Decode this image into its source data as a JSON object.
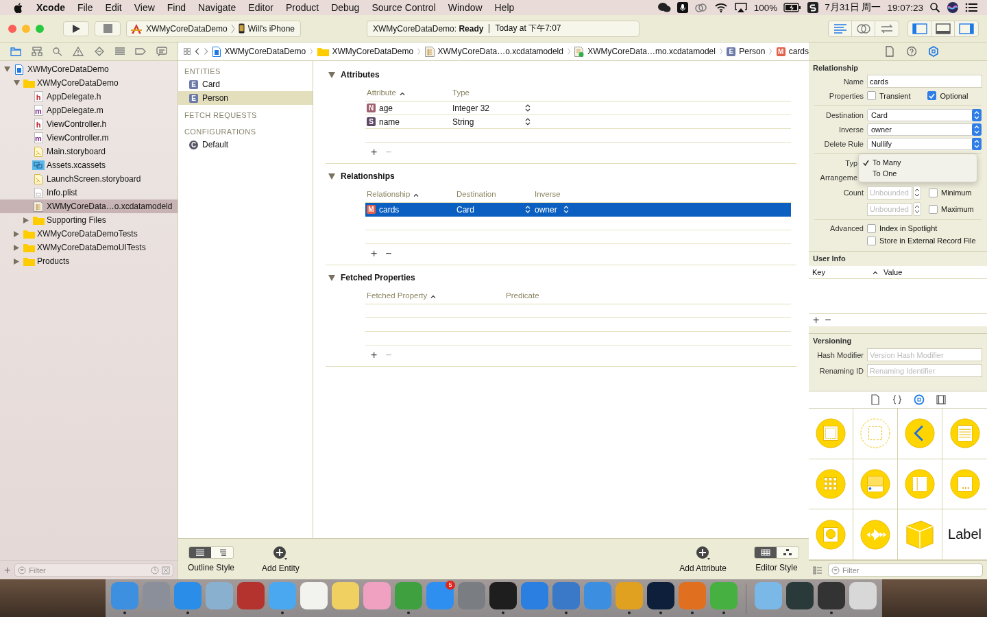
{
  "menu_bar": {
    "app": "Xcode",
    "items": [
      "File",
      "Edit",
      "View",
      "Find",
      "Navigate",
      "Editor",
      "Product",
      "Debug",
      "Source Control",
      "Window",
      "Help"
    ],
    "battery": "100%",
    "date": "7月31日 周一",
    "time": "19:07:23"
  },
  "toolbar": {
    "scheme": "XWMyCoreDataDemo",
    "device": "Will's iPhone",
    "status": "XWMyCoreDataDemo: **Ready**",
    "status_time": "Today at 下午7:07",
    "editor_modes": [
      {
        "kind": "standard",
        "selected": true
      },
      {
        "kind": "assistant",
        "selected": false
      },
      {
        "kind": "version",
        "selected": false
      }
    ],
    "panels": [
      {
        "kind": "left",
        "on": true
      },
      {
        "kind": "bottom",
        "on": false
      },
      {
        "kind": "right",
        "on": true
      }
    ]
  },
  "navigator": {
    "tabs": [
      {
        "kind": "folder",
        "selected": true
      },
      {
        "kind": "hierarchy",
        "selected": false
      },
      {
        "kind": "search",
        "selected": false
      },
      {
        "kind": "warning",
        "selected": false
      },
      {
        "kind": "test",
        "selected": false
      },
      {
        "kind": "debug",
        "selected": false
      },
      {
        "kind": "breakpoint",
        "selected": false
      },
      {
        "kind": "report",
        "selected": false
      }
    ],
    "tree": [
      {
        "label": "XWMyCoreDataDemo",
        "kind": "project",
        "expanded": true,
        "selected": false,
        "children": [
          {
            "label": "XWMyCoreDataDemo",
            "kind": "folder",
            "expanded": true,
            "selected": false,
            "children": [
              {
                "label": "AppDelegate.h",
                "kind": "source",
                "badge": "h",
                "selected": false
              },
              {
                "label": "AppDelegate.m",
                "kind": "source",
                "badge": "m",
                "selected": false
              },
              {
                "label": "ViewController.h",
                "kind": "source",
                "badge": "h",
                "selected": false
              },
              {
                "label": "ViewController.m",
                "kind": "source",
                "badge": "m",
                "selected": false
              },
              {
                "label": "Main.storyboard",
                "kind": "storyboard",
                "selected": false
              },
              {
                "label": "Assets.xcassets",
                "kind": "assets",
                "selected": false
              },
              {
                "label": "LaunchScreen.storyboard",
                "kind": "storyboard",
                "selected": false
              },
              {
                "label": "Info.plist",
                "kind": "plist",
                "selected": false
              },
              {
                "label": "XWMyCoreData…o.xcdatamodeld",
                "kind": "model",
                "selected": true
              },
              {
                "label": "Supporting Files",
                "kind": "folder",
                "expanded": false,
                "selected": false
              }
            ]
          },
          {
            "label": "XWMyCoreDataDemoTests",
            "kind": "folder",
            "expanded": false,
            "selected": false
          },
          {
            "label": "XWMyCoreDataDemoUITests",
            "kind": "folder",
            "expanded": false,
            "selected": false
          },
          {
            "label": "Products",
            "kind": "folder",
            "expanded": false,
            "selected": false
          }
        ]
      }
    ],
    "add": "+",
    "filter_placeholder": "Filter"
  },
  "breadcrumbs": [
    {
      "label": "XWMyCoreDataDemo",
      "kind": "project"
    },
    {
      "label": "XWMyCoreDataDemo",
      "kind": "folder"
    },
    {
      "label": "XWMyCoreData…o.xcdatamodeld",
      "kind": "model"
    },
    {
      "label": "XWMyCoreData…mo.xcdatamodel",
      "kind": "modelfile"
    },
    {
      "label": "Person",
      "kind": "badge",
      "badge": "E",
      "color": "#6c7aa8"
    },
    {
      "label": "cards",
      "kind": "badge",
      "badge": "M",
      "color": "#e0604a"
    }
  ],
  "entity_list": {
    "sections": [
      {
        "title": "ENTITIES",
        "items": [
          {
            "label": "Card",
            "badge": "E",
            "kind": "entity",
            "selected": false
          },
          {
            "label": "Person",
            "badge": "E",
            "kind": "entity",
            "selected": true
          }
        ]
      },
      {
        "title": "FETCH REQUESTS"
      },
      {
        "title": "CONFIGURATIONS",
        "items": [
          {
            "label": "Default",
            "badge": "C",
            "kind": "configuration",
            "selected": false
          }
        ]
      }
    ]
  },
  "editor": {
    "sections": [
      {
        "title": "Attributes",
        "expanded": true,
        "columns": [
          "Attribute",
          "Type"
        ],
        "rows": [
          {
            "badge": "N",
            "cells": [
              "age",
              "Integer 32"
            ],
            "selected": false
          },
          {
            "badge": "S",
            "cells": [
              "name",
              "String"
            ],
            "selected": false
          }
        ],
        "add": "+",
        "remove": "−",
        "remove_disabled": true
      },
      {
        "title": "Relationships",
        "expanded": true,
        "columns": [
          "Relationship",
          "Destination",
          "Inverse"
        ],
        "rows": [
          {
            "badge": "M",
            "cells": [
              "cards",
              "Card",
              "owner"
            ],
            "selected": true
          }
        ],
        "add": "+",
        "remove": "−",
        "remove_disabled": false
      },
      {
        "title": "Fetched Properties",
        "expanded": true,
        "columns": [
          "Fetched Property",
          "Predicate"
        ],
        "add": "+",
        "remove": "−",
        "remove_disabled": true
      }
    ]
  },
  "bottom_bar": {
    "outline_style": {
      "label": "Outline Style",
      "segments": [
        {
          "kind": "table",
          "selected": true
        },
        {
          "kind": "list",
          "selected": false
        }
      ]
    },
    "add_entity": "Add Entity",
    "add_attribute": "Add Attribute",
    "editor_style": {
      "label": "Editor Style",
      "segments": [
        {
          "kind": "table",
          "selected": true
        },
        {
          "kind": "graph",
          "selected": false
        }
      ]
    }
  },
  "inspector": {
    "tabs": [
      {
        "kind": "file",
        "selected": false
      },
      {
        "kind": "help",
        "selected": false
      },
      {
        "kind": "attributes",
        "selected": true
      }
    ],
    "relationship": {
      "title": "Relationship",
      "name_label": "Name",
      "name": "cards",
      "properties_label": "Properties",
      "properties": [
        {
          "label": "Transient",
          "checked": false
        },
        {
          "label": "Optional",
          "checked": true
        }
      ],
      "popups": [
        {
          "label": "Destination",
          "value": "Card"
        },
        {
          "label": "Inverse",
          "value": "owner"
        },
        {
          "label": "Delete Rule",
          "value": "Nullify"
        }
      ],
      "type_label": "Typ",
      "arrangement_label": "Arrangeme",
      "type_menu": [
        {
          "label": "To Many",
          "checked": true
        },
        {
          "label": "To One",
          "checked": false
        }
      ],
      "count_label": "Count",
      "count": [
        {
          "placeholder": "Unbounded",
          "label": "Minimum",
          "checked": false
        },
        {
          "placeholder": "Unbounded",
          "label": "Maximum",
          "checked": false
        }
      ],
      "advanced_label": "Advanced",
      "advanced": [
        {
          "label": "Index in Spotlight",
          "checked": false
        },
        {
          "label": "Store in External Record File",
          "checked": false
        }
      ]
    },
    "user_info": {
      "title": "User Info",
      "columns": [
        "Key",
        "Value"
      ],
      "add": "+",
      "remove": "−"
    },
    "versioning": {
      "title": "Versioning",
      "fields": [
        {
          "label": "Hash Modifier",
          "placeholder": "Version Hash Modifier"
        },
        {
          "label": "Renaming ID",
          "placeholder": "Renaming Identifier"
        }
      ]
    },
    "library": {
      "tabs": [
        {
          "kind": "file",
          "selected": false
        },
        {
          "kind": "code",
          "selected": false
        },
        {
          "kind": "object",
          "selected": true
        },
        {
          "kind": "media",
          "selected": false
        }
      ],
      "items": [
        {
          "kind": "view"
        },
        {
          "kind": "container"
        },
        {
          "kind": "back"
        },
        {
          "kind": "table"
        },
        {
          "kind": "grid"
        },
        {
          "kind": "tabbar"
        },
        {
          "kind": "split"
        },
        {
          "kind": "page"
        },
        {
          "kind": "button"
        },
        {
          "kind": "media"
        },
        {
          "kind": "cube"
        },
        {
          "kind": "label",
          "text": "Label"
        }
      ],
      "filter_placeholder": "Filter"
    }
  },
  "dock": {
    "apps": [
      {
        "color": "#3d8fe0",
        "running": true
      },
      {
        "color": "#8a8f99",
        "running": false
      },
      {
        "color": "#2a8ee8",
        "running": true
      },
      {
        "color": "#8ab0d0",
        "running": false
      },
      {
        "color": "#b5332e",
        "running": false
      },
      {
        "color": "#4aa8f0",
        "running": true
      },
      {
        "color": "#f2f2ee",
        "running": false
      },
      {
        "color": "#f0d060",
        "running": false
      },
      {
        "color": "#f0a0c0",
        "running": false
      },
      {
        "color": "#3fa040",
        "running": true
      },
      {
        "color": "#2f8ff0",
        "running": false,
        "badge": "5"
      },
      {
        "color": "#7a7d82",
        "running": false
      },
      {
        "color": "#1e1e1e",
        "running": true
      },
      {
        "color": "#2a7fe0",
        "running": false
      },
      {
        "color": "#3a78c8",
        "running": true
      },
      {
        "color": "#3b8ee0",
        "running": false
      },
      {
        "color": "#e0a020",
        "running": true
      },
      {
        "color": "#0d1f3a",
        "running": true
      },
      {
        "color": "#e07020",
        "running": true
      },
      {
        "color": "#46b040",
        "running": true
      }
    ],
    "others": [
      {
        "color": "#7ab8e8",
        "running": false
      },
      {
        "color": "#2a3a3a",
        "running": false
      },
      {
        "color": "#333333",
        "running": true
      },
      {
        "color": "#d8d8d8",
        "running": false
      }
    ]
  }
}
